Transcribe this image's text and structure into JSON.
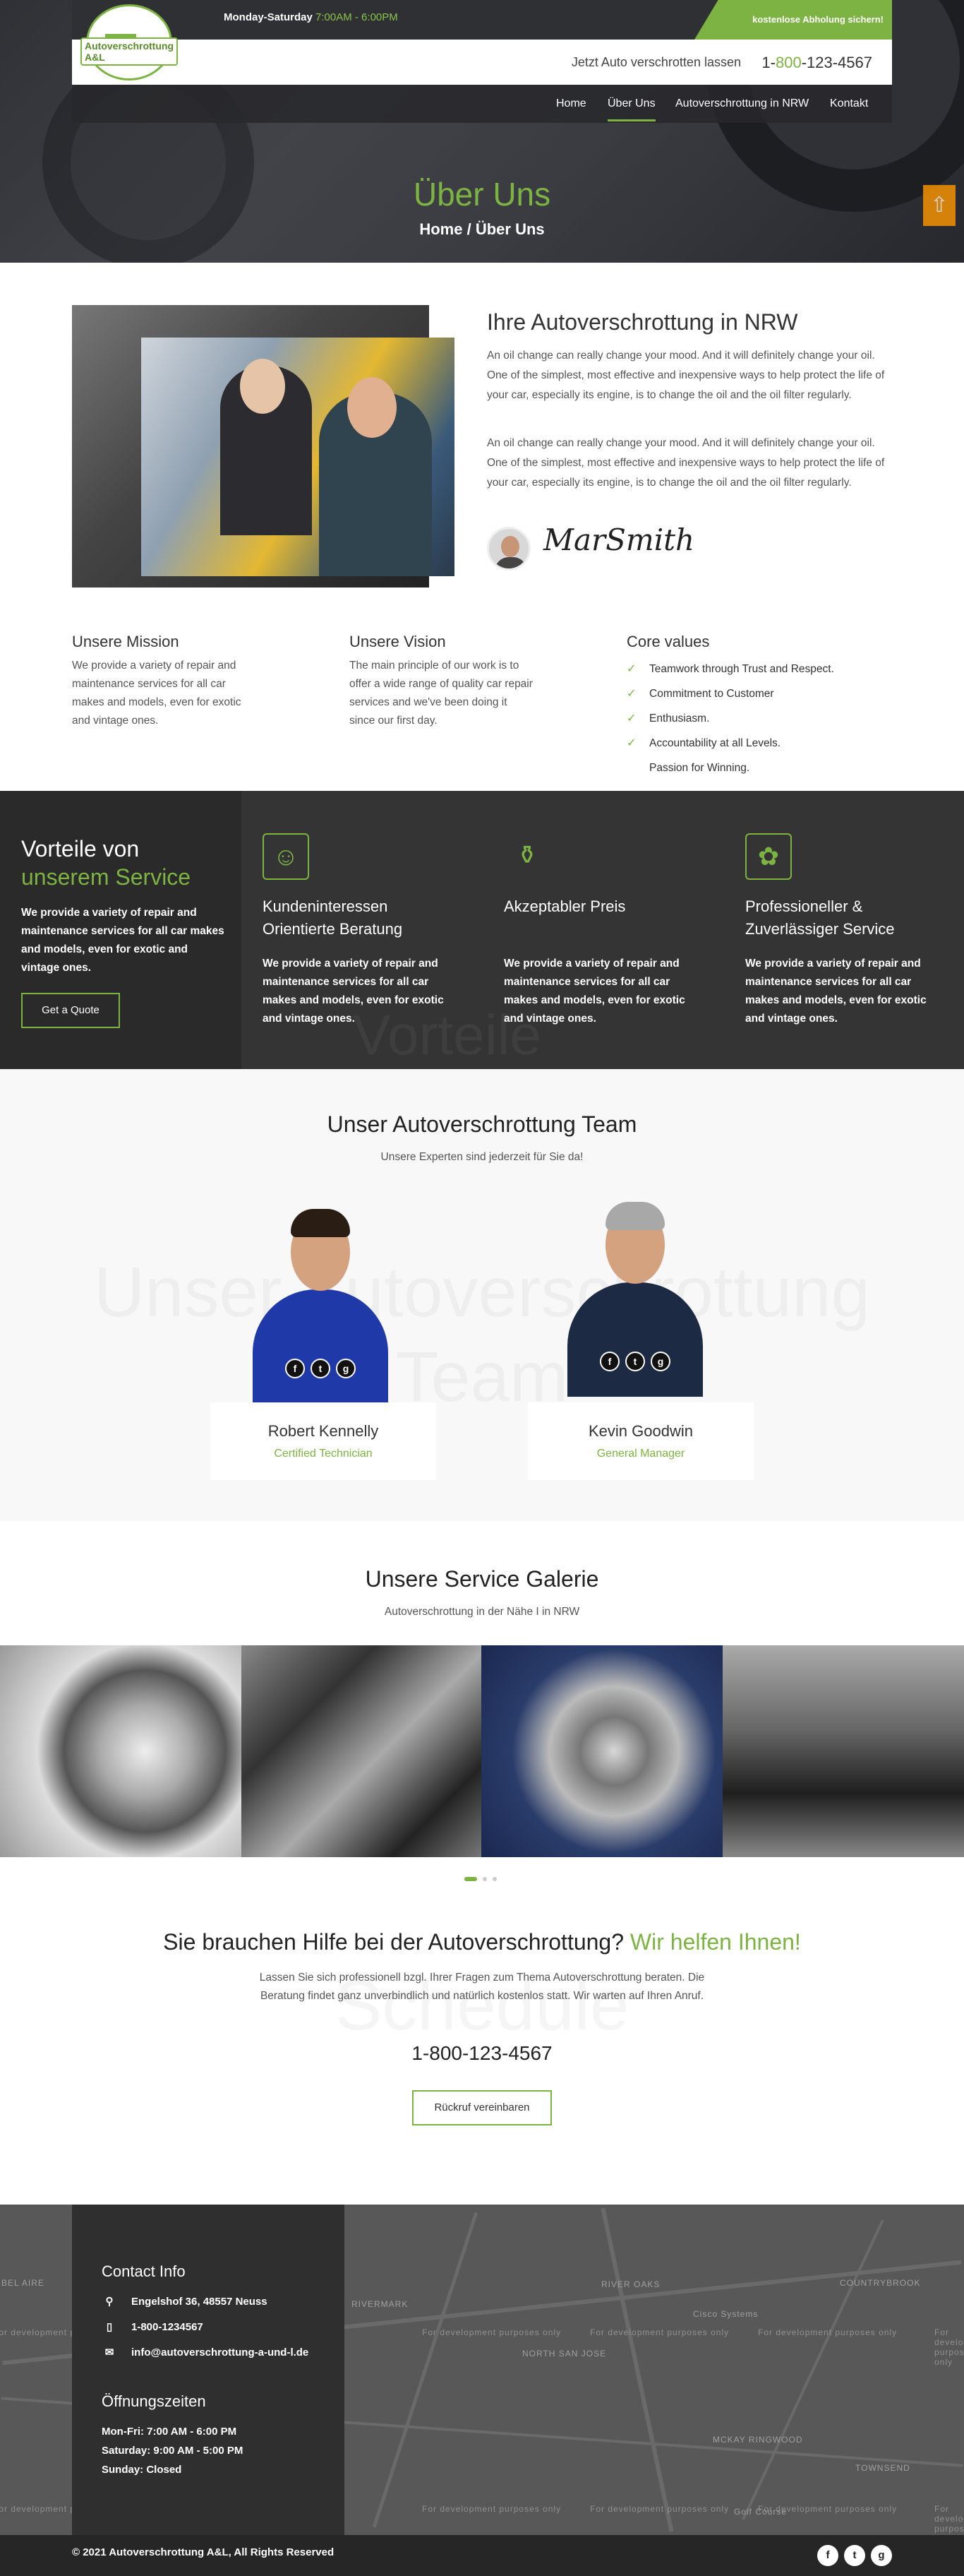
{
  "header": {
    "hours_label": "Monday-Saturday",
    "hours_value": "7:00AM - 6:00PM",
    "pickup_badge": "kostenlose Abholung sichern!",
    "cta_text": "Jetzt Auto verschrotten lassen",
    "phone_prefix": "1-",
    "phone_accent": "800",
    "phone_suffix": "-123-4567",
    "logo_text": "Autoverschrottung A&L"
  },
  "nav": {
    "items": [
      {
        "label": "Home"
      },
      {
        "label": "Über Uns"
      },
      {
        "label": "Autoverschrottung in NRW"
      },
      {
        "label": "Kontakt"
      }
    ]
  },
  "hero": {
    "title": "Über Uns",
    "breadcrumb_home": "Home /",
    "breadcrumb_current": "Über Uns"
  },
  "about": {
    "title": "Ihre Autoverschrottung in NRW",
    "paragraph1": "An oil change can really change your mood. And it will definitely change your oil. One of the simplest, most effective and inexpensive ways to help protect the life of your car, especially its engine, is to change the oil and the oil filter regularly.",
    "paragraph2": "An oil change can really change your mood. And it will definitely change your oil. One of the simplest, most effective and inexpensive ways to help protect the life of your car, especially its engine, is to change the oil and the oil filter regularly.",
    "signature": "MarSmith"
  },
  "columns": {
    "mission_title": "Unsere Mission",
    "mission_text": "We provide a variety of repair and maintenance services for all car makes and models, even for exotic and vintage ones.",
    "vision_title": "Unsere Vision",
    "vision_text": "The main principle of our work is to offer a wide range of quality car repair services and we've been doing it since our first day.",
    "values_title": "Core values",
    "values": [
      "Teamwork through Trust and Respect.",
      "Commitment to Customer",
      "Enthusiasm.",
      "Accountability at all Levels.",
      "Passion for Winning."
    ]
  },
  "vorteile": {
    "title_line1": "Vorteile von",
    "title_line2": "unserem Service",
    "text": "We provide a variety of repair and maintenance services for all car makes and models, even for exotic and vintage ones.",
    "button": "Get a Quote",
    "bg_word": "Vorteile",
    "items": [
      {
        "icon": "advisor-icon",
        "title": "Kundeninteressen Orientierte Beratung",
        "text": "We provide a variety of repair and maintenance services for all car makes and models, even for exotic and vintage ones."
      },
      {
        "icon": "price-tag-icon",
        "title": "Akzeptabler Preis",
        "text": "We provide a variety of repair and maintenance services for all car makes and models, even for exotic and vintage ones."
      },
      {
        "icon": "fan-icon",
        "title": "Professioneller & Zuverlässiger Service",
        "text": "We provide a variety of repair and maintenance services for all car makes and models, even for exotic and vintage ones."
      }
    ]
  },
  "team": {
    "title": "Unser Autoverschrottung Team",
    "subtitle": "Unsere Experten sind jederzeit für Sie da!",
    "bg_line1": "Unser Autoverschrottung",
    "bg_line2": "Team",
    "members": [
      {
        "name": "Robert Kennelly",
        "role": "Certified Technician"
      },
      {
        "name": "Kevin Goodwin",
        "role": "General Manager"
      }
    ]
  },
  "gallery": {
    "title": "Unsere Service Galerie",
    "subtitle": "Autoverschrottung in der Nähe I in NRW"
  },
  "help": {
    "title": "Sie brauchen Hilfe bei der Autoverschrottung?",
    "title_accent": "Wir helfen Ihnen!",
    "text": "Lassen Sie sich professionell bzgl. Ihrer Fragen zum Thema Autoverschrottung beraten. Die Beratung findet ganz unverbindlich und natürlich kostenlos statt. Wir warten auf Ihren Anruf.",
    "bg_word": "Schedule",
    "phone": "1-800-123-4567",
    "button": "Rückruf vereinbaren"
  },
  "contact": {
    "title": "Contact Info",
    "address": "Engelshof 36, 48557 Neuss",
    "phone": "1-800-1234567",
    "email": "info@autoverschrottung-a-und-l.de",
    "hours_title": "Öffnungszeiten",
    "hours": [
      "Mon-Fri: 7:00 AM - 6:00 PM",
      "Saturday: 9:00 AM - 5:00 PM",
      "Sunday: Closed"
    ]
  },
  "map": {
    "watermark": "For development purposes only",
    "labels": [
      "RIVER OAKS",
      "RIVERMARK",
      "NORTH SAN JOSE",
      "COUNTRYBROOK",
      "TOWNSEND",
      "MCKAY RINGWOOD",
      "BEL AIRE",
      "Cisco Systems",
      "Golf Course"
    ]
  },
  "footer": {
    "copyright": "© 2021 Autoverschrottung A&L, All Rights Reserved",
    "social": [
      "facebook-icon",
      "twitter-icon",
      "google-plus-icon"
    ]
  },
  "colors": {
    "accent": "#7cb342",
    "dark": "#2f3033",
    "footer": "#262626"
  }
}
